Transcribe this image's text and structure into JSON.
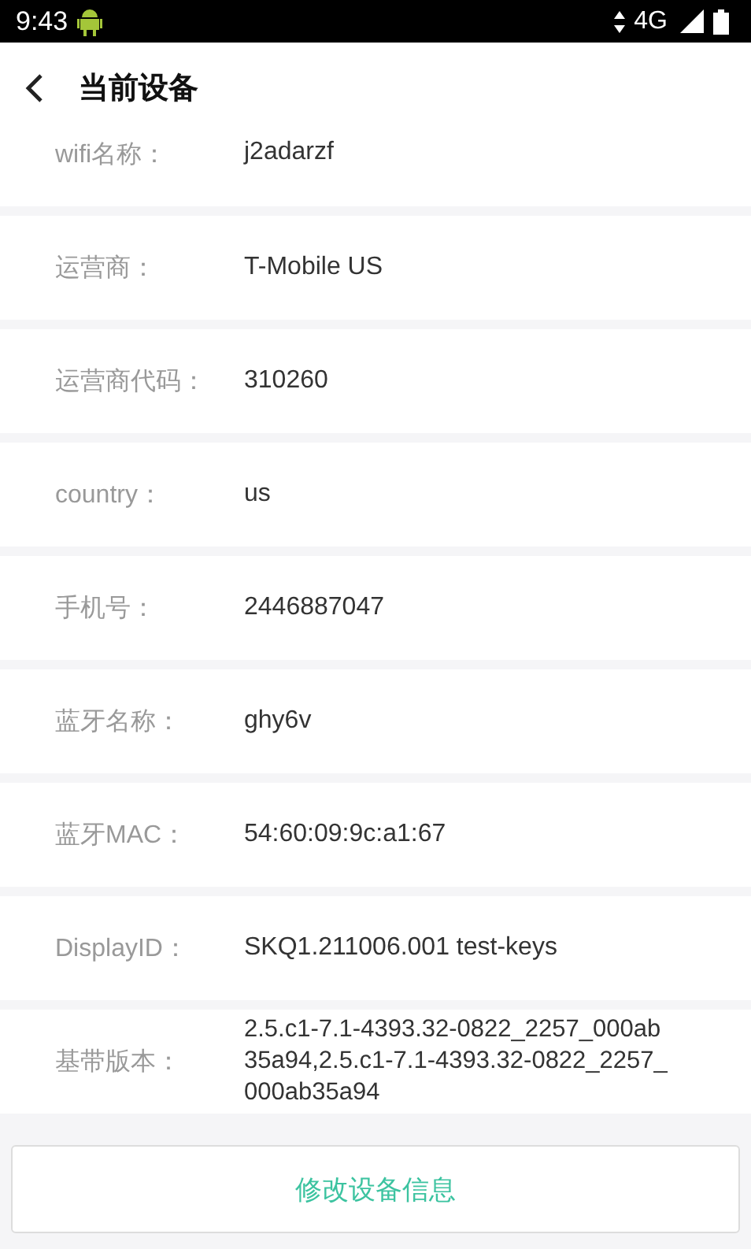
{
  "status_bar": {
    "time": "9:43",
    "network": "4G"
  },
  "header": {
    "title": "当前设备"
  },
  "rows": [
    {
      "label": "wifi名称：",
      "value": "j2adarzf"
    },
    {
      "label": "运营商：",
      "value": "T-Mobile US"
    },
    {
      "label": "运营商代码：",
      "value": "310260"
    },
    {
      "label": "country：",
      "value": "us"
    },
    {
      "label": "手机号：",
      "value": "2446887047"
    },
    {
      "label": "蓝牙名称：",
      "value": "ghy6v"
    },
    {
      "label": "蓝牙MAC：",
      "value": "54:60:09:9c:a1:67"
    },
    {
      "label": "DisplayID：",
      "value": "SKQ1.211006.001 test-keys"
    },
    {
      "label": "基带版本：",
      "value_lines": [
        "2.5.c1-7.1-4393.32-0822_2257_000ab",
        "35a94,2.5.c1-7.1-4393.32-0822_2257_",
        "000ab35a94"
      ]
    }
  ],
  "button": {
    "label": "修改设备信息"
  }
}
